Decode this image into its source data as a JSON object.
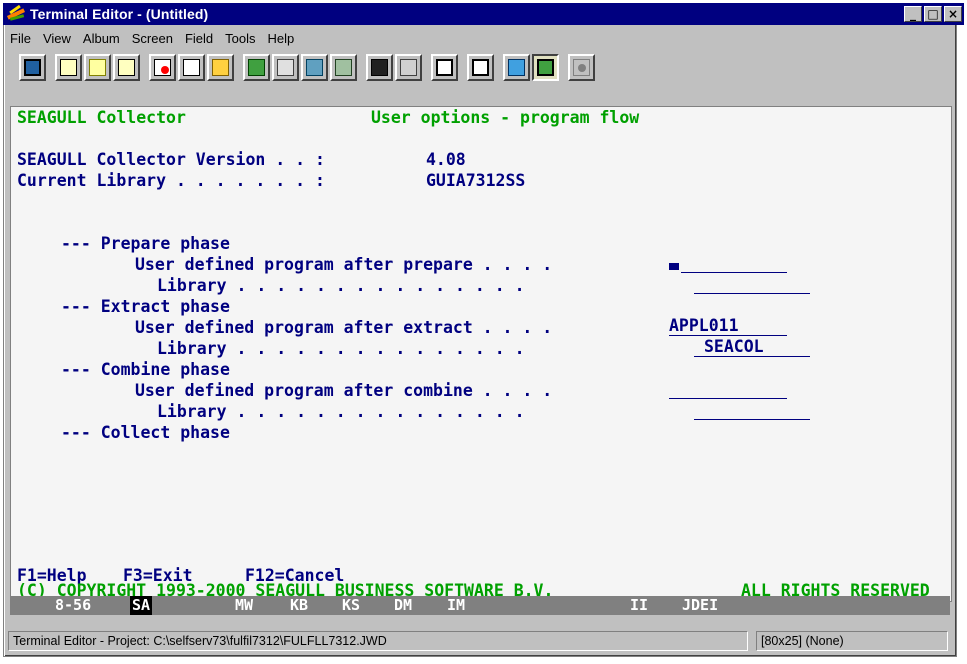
{
  "window": {
    "title": "Terminal Editor - (Untitled)"
  },
  "menu": [
    "File",
    "View",
    "Album",
    "Screen",
    "Field",
    "Tools",
    "Help"
  ],
  "toolbar_icons": [
    "app-icon",
    "screen-icon",
    "select-icon",
    "draw-icon",
    "record-icon",
    "field-icon",
    "open-folder-icon",
    "component-icon",
    "check-icon",
    "web-icon",
    "grid-icon",
    "table-icon",
    "layout-icon",
    "hand-edit-icon",
    "print-icon",
    "display-icon",
    "book-icon",
    "key-icon"
  ],
  "terminal": {
    "header_left": "SEAGULL Collector",
    "header_right": "User options - program flow",
    "version_label": "SEAGULL Collector Version . . :",
    "version_value": "4.08",
    "library_label": "Current Library . . . . . . . :",
    "library_value": "GUIA7312SS",
    "prepare_phase": "--- Prepare phase",
    "prepare_prog_label": "User defined program after prepare . . . .",
    "prepare_lib_label": "Library . . . . . . . . . . . . . . .",
    "prepare_prog_value": "",
    "prepare_lib_value": "",
    "extract_phase": "--- Extract phase",
    "extract_prog_label": "User defined program after extract . . . .",
    "extract_lib_label": "Library . . . . . . . . . . . . . . .",
    "extract_prog_value": "APPL011",
    "extract_lib_value": "SEACOL",
    "combine_phase": "--- Combine phase",
    "combine_prog_label": "User defined program after combine . . . .",
    "combine_lib_label": "Library . . . . . . . . . . . . . . .",
    "combine_prog_value": "",
    "combine_lib_value": "",
    "collect_phase": "--- Collect phase",
    "fkey_help": "F1=Help",
    "fkey_exit": "F3=Exit",
    "fkey_cancel": "F12=Cancel",
    "copyright_left": "(C) COPYRIGHT 1993-2000 SEAGULL BUSINESS SOFTWARE B.V.",
    "copyright_right": "ALL RIGHTS RESERVED"
  },
  "oia": {
    "pos": "8-56",
    "sa": "SA",
    "mw": "MW",
    "kb": "KB",
    "ks": "KS",
    "dm": "DM",
    "im": "IM",
    "ii": "II",
    "jdei": "JDEI"
  },
  "status": {
    "project": "Terminal Editor - Project: C:\\selfserv73\\fulfil7312\\FULFLL7312.JWD",
    "size": "[80x25] (None)"
  },
  "colors": {
    "terminal_text": "#000080",
    "terminal_header": "#00a000",
    "title_bar": "#000080"
  }
}
